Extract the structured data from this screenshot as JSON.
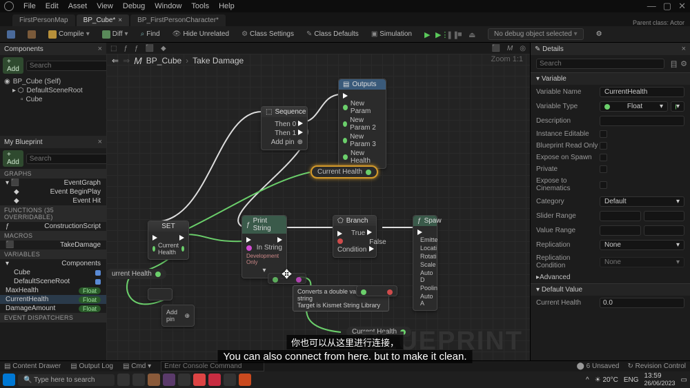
{
  "menubar": {
    "items": [
      "File",
      "Edit",
      "Asset",
      "View",
      "Debug",
      "Window",
      "Tools",
      "Help"
    ]
  },
  "window_controls": {
    "min": "—",
    "max": "▢",
    "close": "✕"
  },
  "tabs": {
    "t0": "FirstPersonMap",
    "t1": "BP_Cube*",
    "t2": "BP_FirstPersonCharacter*",
    "right": "Parent class: Actor"
  },
  "toolbar": {
    "compile": "Compile",
    "diff": "Diff",
    "find": "Find",
    "hide": "Hide Unrelated",
    "settings": "Class Settings",
    "defaults": "Class Defaults",
    "simulation": "Simulation",
    "debug_dd": "No debug object selected"
  },
  "components": {
    "title": "Components",
    "add": "Add",
    "search_ph": "Search",
    "root": "BP_Cube (Self)",
    "scene": "DefaultSceneRoot",
    "cube": "Cube"
  },
  "myblueprint": {
    "title": "My Blueprint",
    "add": "Add",
    "search_ph": "Search",
    "graphs_hdr": "GRAPHS",
    "eventgraph": "EventGraph",
    "beginplay": "Event BeginPlay",
    "hit": "Event Hit",
    "functions_hdr": "FUNCTIONS (35 OVERRIDABLE)",
    "constr": "ConstructionScript",
    "macros_hdr": "MACROS",
    "takedmg": "TakeDamage",
    "variables_hdr": "VARIABLES",
    "comp_hdr": "Components",
    "cube": "Cube",
    "scene": "DefaultSceneRoot",
    "maxhealth": "MaxHealth",
    "currenthealth": "CurrentHealth",
    "damageamount": "DamageAmount",
    "float": "Float",
    "ed_hdr": "EVENT DISPATCHERS"
  },
  "graph": {
    "crumb_a": "BP_Cube",
    "crumb_b": "Take Damage",
    "zoom": "Zoom 1:1",
    "watermark": "BLUEPRINT",
    "sequence": {
      "title": "Sequence",
      "then0": "Then 0",
      "then1": "Then 1",
      "addpin": "Add pin"
    },
    "outputs": {
      "title": "Outputs",
      "p1": "New Param",
      "p2": "New Param 2",
      "p3": "New Param 3",
      "p4": "New Health"
    },
    "curhealth_chip": "Current Health",
    "set": {
      "title": "SET",
      "var": "Current Health",
      "addpin": "Add pin"
    },
    "curhealth_in": "urrent Health",
    "print": {
      "title": "Print String",
      "instr": "In String",
      "dev": "Development Only"
    },
    "branch": {
      "title": "Branch",
      "cond": "Condition",
      "true": "True",
      "false": "False"
    },
    "spawn": {
      "title": "Spaw",
      "emit": "Emitte",
      "loc": "Locati",
      "rot": "Rotati",
      "scale": "Scale",
      "autod": "Auto D",
      "pool": "Poolin",
      "autoa": "Auto A"
    },
    "curhealth_bot": "Current Health",
    "tooltip": {
      "l1": "Converts a double value to a string",
      "l2": "Target is Kismet String Library"
    }
  },
  "details": {
    "title": "Details",
    "search_ph": "Search",
    "sec_var": "Variable",
    "varname_l": "Variable Name",
    "varname_v": "CurrentHealth",
    "vartype_l": "Variable Type",
    "vartype_v": "Float",
    "desc_l": "Description",
    "inst_l": "Instance Editable",
    "bpro_l": "Blueprint Read Only",
    "spawn_l": "Expose on Spawn",
    "priv_l": "Private",
    "cine_l": "Expose to Cinematics",
    "cat_l": "Category",
    "cat_v": "Default",
    "slider_l": "Slider Range",
    "value_l": "Value Range",
    "rep_l": "Replication",
    "rep_v": "None",
    "repc_l": "Replication Condition",
    "repc_v": "None",
    "adv": "Advanced",
    "sec_def": "Default Value",
    "defv_l": "Current Health",
    "defv_v": "0.0"
  },
  "statusbar": {
    "drawer": "Content Drawer",
    "output": "Output Log",
    "cmd": "Cmd",
    "cmd_ph": "Enter Console Command",
    "unsaved": "6 Unsaved",
    "rev": "Revision Control"
  },
  "taskbar": {
    "search": "Type here to search",
    "weather": "20°C",
    "lang": "ENG",
    "time": "13:59",
    "date": "26/06/2023"
  },
  "subs": {
    "cn": "你也可以从这里进行连接，",
    "en": "You can also connect from here. but to make it clean."
  }
}
